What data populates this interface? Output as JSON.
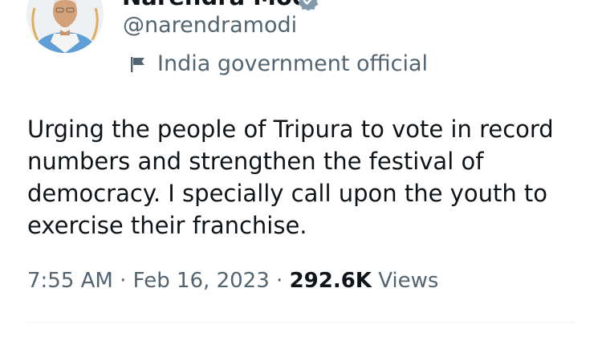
{
  "author": {
    "display_name": "Narendra Modi",
    "handle": "@narendramodi",
    "label": "India government official",
    "verified_badge_color": "#829aab"
  },
  "tweet": {
    "text_lines": [
      "Urging the people of Tripura to vote in record",
      "numbers and strengthen the festival of",
      "democracy. I specially call upon the youth to",
      "exercise their franchise."
    ],
    "time": "7:55 AM",
    "date": "Feb 16, 2023",
    "separator": "·",
    "views_count": "292.6K",
    "views_label": "Views"
  },
  "colors": {
    "primary_text": "#0f1419",
    "secondary_text": "#536471",
    "divider": "#eff3f4"
  }
}
